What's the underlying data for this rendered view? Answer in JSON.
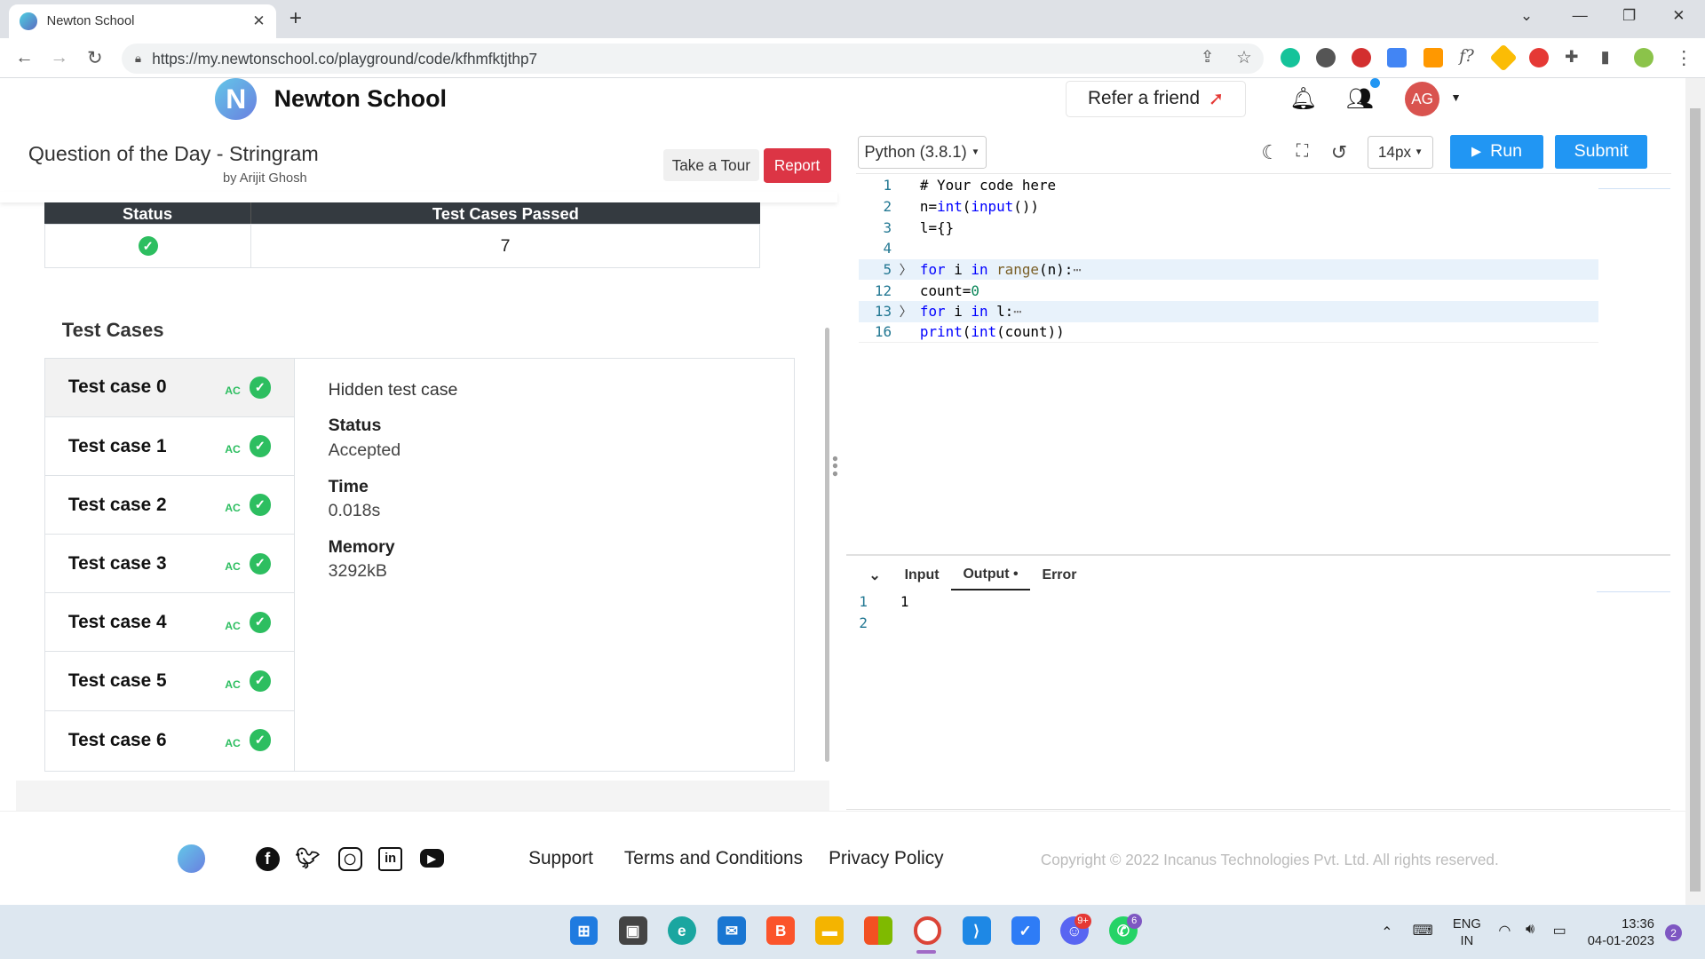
{
  "browser": {
    "tab_title": "Newton School",
    "url": "https://my.newtonschool.co/playground/code/kfhmfktjthp7"
  },
  "header": {
    "brand": "Newton School",
    "refer": "Refer a friend",
    "avatar_initials": "AG"
  },
  "question": {
    "title": "Question of the Day - Stringram",
    "author": "by Arijit Ghosh",
    "take_tour": "Take a Tour",
    "report": "Report"
  },
  "results": {
    "col_status": "Status",
    "col_passed": "Test Cases Passed",
    "passed_value": "7"
  },
  "test_cases": {
    "heading": "Test Cases",
    "items": [
      {
        "label": "Test case 0",
        "verdict": "AC"
      },
      {
        "label": "Test case 1",
        "verdict": "AC"
      },
      {
        "label": "Test case 2",
        "verdict": "AC"
      },
      {
        "label": "Test case 3",
        "verdict": "AC"
      },
      {
        "label": "Test case 4",
        "verdict": "AC"
      },
      {
        "label": "Test case 5",
        "verdict": "AC"
      },
      {
        "label": "Test case 6",
        "verdict": "AC"
      }
    ],
    "detail": {
      "title": "Hidden test case",
      "status_label": "Status",
      "status_value": "Accepted",
      "time_label": "Time",
      "time_value": "0.018s",
      "memory_label": "Memory",
      "memory_value": "3292kB"
    }
  },
  "editor": {
    "language": "Python (3.8.1)",
    "font_size": "14px",
    "run": "Run",
    "submit": "Submit",
    "line_numbers": [
      "1",
      "2",
      "3",
      "4",
      "5",
      "12",
      "13",
      "16"
    ]
  },
  "io": {
    "tab_input": "Input",
    "tab_output": "Output •",
    "tab_error": "Error",
    "output_line_numbers": [
      "1",
      "2"
    ],
    "output_value": "1"
  },
  "footer": {
    "support": "Support",
    "terms": "Terms and Conditions",
    "privacy": "Privacy Policy",
    "copyright": "Copyright © 2022 Incanus Technologies Pvt. Ltd. All rights reserved."
  },
  "taskbar": {
    "lang_top": "ENG",
    "lang_bottom": "IN",
    "time": "13:36",
    "date": "04-01-2023",
    "notification_count": "2",
    "discord_badge": "9+",
    "whatsapp_badge": "6"
  },
  "colors": {
    "accent": "#2196f3",
    "report": "#dc3545",
    "success": "#2dbe60"
  }
}
